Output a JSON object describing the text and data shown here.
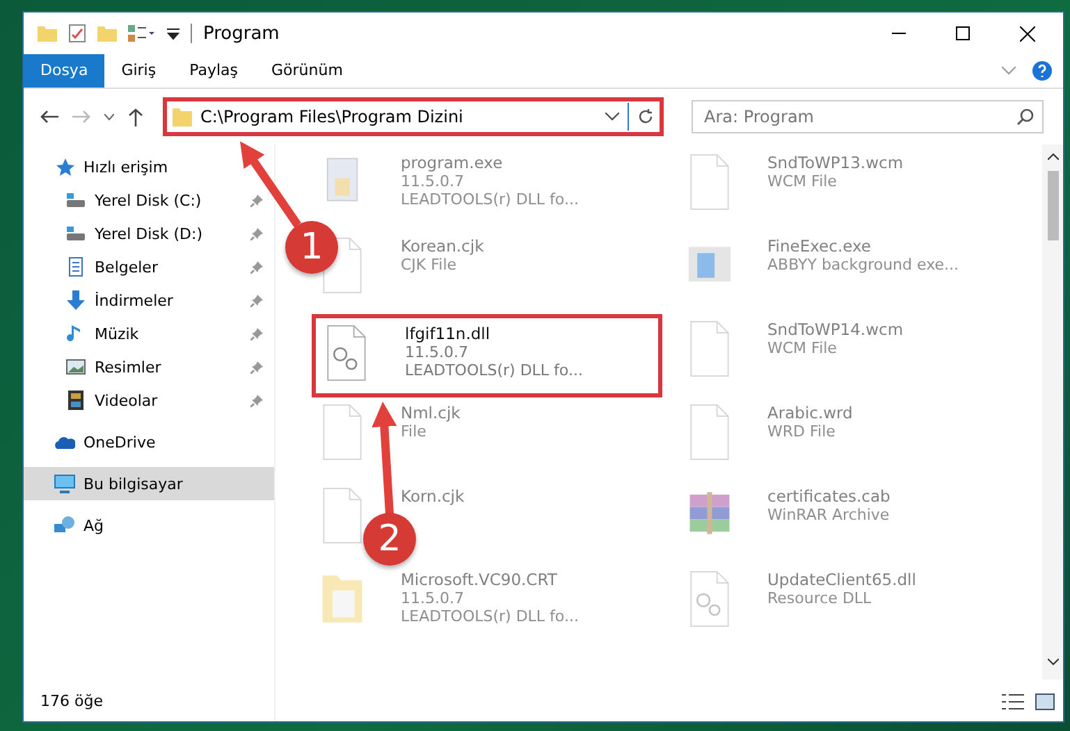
{
  "window": {
    "title": "Program"
  },
  "ribbon_tabs": [
    {
      "label": "Dosya",
      "selected": true
    },
    {
      "label": "Giriş",
      "selected": false
    },
    {
      "label": "Paylaş",
      "selected": false
    },
    {
      "label": "Görünüm",
      "selected": false
    }
  ],
  "address_bar": {
    "path": "C:\\Program Files\\Program Dizini",
    "highlighted": true
  },
  "search": {
    "placeholder": "Ara: Program"
  },
  "sidebar": {
    "items": [
      {
        "label": "Hızlı erişim",
        "kind": "star",
        "selected": false,
        "pinned": false,
        "children": [
          {
            "label": "Yerel Disk (C:)",
            "kind": "drive",
            "selected": false,
            "pinned": true
          },
          {
            "label": "Yerel Disk (D:)",
            "kind": "drive",
            "selected": false,
            "pinned": true
          },
          {
            "label": "Belgeler",
            "kind": "docs",
            "selected": false,
            "pinned": true
          },
          {
            "label": "İndirmeler",
            "kind": "download",
            "selected": false,
            "pinned": true
          },
          {
            "label": "Müzik",
            "kind": "music",
            "selected": false,
            "pinned": true
          },
          {
            "label": "Resimler",
            "kind": "pictures",
            "selected": false,
            "pinned": true
          },
          {
            "label": "Videolar",
            "kind": "videos",
            "selected": false,
            "pinned": true
          }
        ]
      },
      {
        "label": "OneDrive",
        "kind": "cloud",
        "selected": false,
        "pinned": false
      },
      {
        "label": "Bu bilgisayar",
        "kind": "pc",
        "selected": true,
        "pinned": false
      },
      {
        "label": "Ağ",
        "kind": "network",
        "selected": false,
        "pinned": false
      }
    ]
  },
  "files": [
    {
      "name": "program.exe",
      "lines": [
        "11.5.0.7",
        "LEADTOOLS(r) DLL fo..."
      ],
      "kind": "exe",
      "faded": true,
      "highlighted": false
    },
    {
      "name": "SndToWP13.wcm",
      "lines": [
        "WCM File"
      ],
      "kind": "doc",
      "faded": true,
      "highlighted": false
    },
    {
      "name": "Korean.cjk",
      "lines": [
        "CJK File"
      ],
      "kind": "doc",
      "faded": true,
      "highlighted": false
    },
    {
      "name": "FineExec.exe",
      "lines": [
        "ABBYY background exe..."
      ],
      "kind": "app",
      "faded": true,
      "highlighted": false
    },
    {
      "name": "lfgif11n.dll",
      "lines": [
        "11.5.0.7",
        "LEADTOOLS(r) DLL fo..."
      ],
      "kind": "dll",
      "faded": false,
      "highlighted": true
    },
    {
      "name": "SndToWP14.wcm",
      "lines": [
        "WCM File"
      ],
      "kind": "doc",
      "faded": true,
      "highlighted": false
    },
    {
      "name": "Nml.cjk",
      "lines": [
        "File"
      ],
      "kind": "doc",
      "faded": true,
      "highlighted": false
    },
    {
      "name": "Arabic.wrd",
      "lines": [
        "WRD File"
      ],
      "kind": "doc",
      "faded": true,
      "highlighted": false
    },
    {
      "name": "Korn.cjk",
      "kind": "doc",
      "faded": true,
      "highlighted": false
    },
    {
      "name": "certificates.cab",
      "lines": [
        "WinRAR Archive"
      ],
      "kind": "cab",
      "faded": true,
      "highlighted": false
    },
    {
      "name": "Microsoft.VC90.CRT",
      "lines": [
        "11.5.0.7",
        "LEADTOOLS(r) DLL fo..."
      ],
      "kind": "folder",
      "faded": true,
      "highlighted": false
    },
    {
      "name": "UpdateClient65.dll",
      "lines": [
        "Resource DLL"
      ],
      "kind": "dll",
      "faded": true,
      "highlighted": false
    }
  ],
  "status_bar": {
    "count": "176 öğe"
  },
  "annotations": [
    {
      "label": "1"
    },
    {
      "label": "2"
    }
  ]
}
